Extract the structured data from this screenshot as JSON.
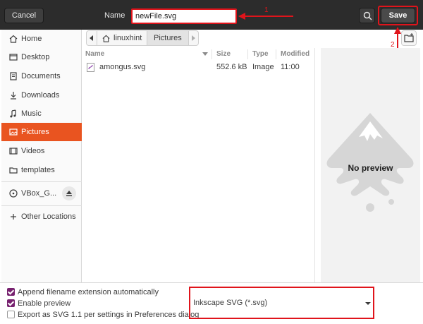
{
  "header": {
    "cancel_label": "Cancel",
    "name_label": "Name",
    "filename_value": "newFile.svg",
    "save_label": "Save"
  },
  "annotations": {
    "step1": "1",
    "step2": "2",
    "highlight_color": "#e0141b"
  },
  "sidebar": {
    "items": [
      {
        "label": "Home",
        "icon": "home-icon"
      },
      {
        "label": "Desktop",
        "icon": "desktop-icon"
      },
      {
        "label": "Documents",
        "icon": "documents-icon"
      },
      {
        "label": "Downloads",
        "icon": "downloads-icon"
      },
      {
        "label": "Music",
        "icon": "music-icon"
      },
      {
        "label": "Pictures",
        "icon": "pictures-icon",
        "active": true
      },
      {
        "label": "Videos",
        "icon": "videos-icon"
      },
      {
        "label": "templates",
        "icon": "folder-icon"
      }
    ],
    "devices": [
      {
        "label": "VBox_G...",
        "icon": "disc-icon",
        "eject_icon": "eject-icon"
      }
    ],
    "other_locations_label": "Other Locations",
    "active_color": "#e95420"
  },
  "pathbar": {
    "home_label": "linuxhint",
    "current_label": "Pictures"
  },
  "filelist": {
    "columns": [
      "Name",
      "Size",
      "Type",
      "Modified"
    ],
    "rows": [
      {
        "name": "amongus.svg",
        "size": "552.6 kB",
        "type": "Image",
        "modified": "11:00"
      }
    ]
  },
  "preview": {
    "text": "No preview"
  },
  "options": {
    "append_extension": {
      "label": "Append filename extension automatically",
      "checked": true
    },
    "enable_preview": {
      "label": "Enable preview",
      "checked": true
    },
    "export_svg11": {
      "label": "Export as SVG 1.1 per settings in Preferences dialog",
      "checked": false
    }
  },
  "filter": {
    "selected": "Inkscape SVG (*.svg)"
  }
}
